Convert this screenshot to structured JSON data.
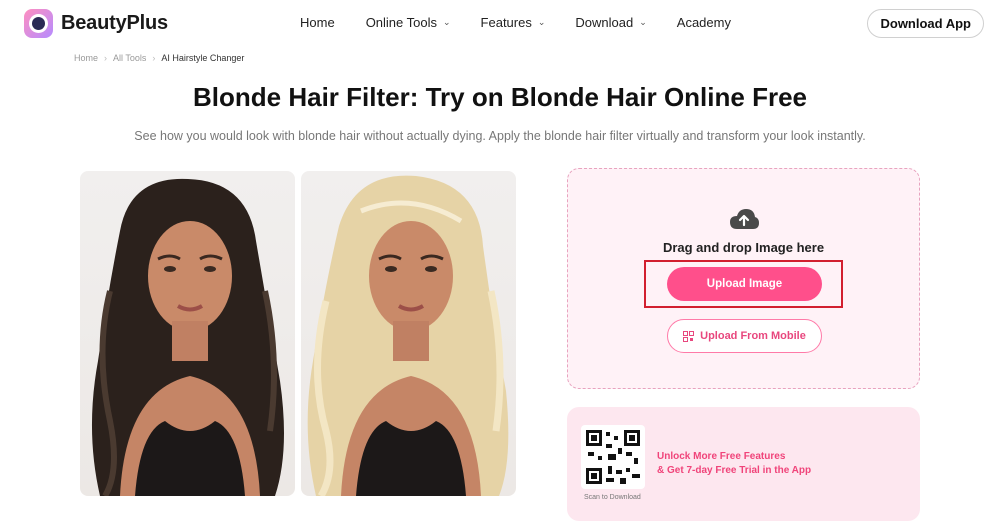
{
  "header": {
    "brand": "BeautyPlus",
    "nav": [
      {
        "label": "Home",
        "has_dropdown": false
      },
      {
        "label": "Online Tools",
        "has_dropdown": true
      },
      {
        "label": "Features",
        "has_dropdown": true
      },
      {
        "label": "Download",
        "has_dropdown": true
      },
      {
        "label": "Academy",
        "has_dropdown": false
      }
    ],
    "download_label": "Download App"
  },
  "breadcrumb": [
    "Home",
    "All Tools",
    "AI Hairstyle Changer"
  ],
  "page": {
    "title": "Blonde Hair Filter: Try on Blonde Hair Online Free",
    "subtitle": "See how you would look with blonde hair without actually dying. Apply the blonde hair filter virtually and transform your look instantly."
  },
  "upload": {
    "drag_text": "Drag and drop Image here",
    "upload_label": "Upload Image",
    "mobile_label": "Upload From Mobile"
  },
  "promo": {
    "line1": "Unlock More Free Features",
    "line2": "& Get 7-day Free Trial in the App",
    "scan_text": "Scan to Download"
  },
  "colors": {
    "accent": "#ff4f8b",
    "highlight": "#d21f2f",
    "upload_bg": "#fff2f7",
    "promo_bg": "#fde7ef"
  }
}
